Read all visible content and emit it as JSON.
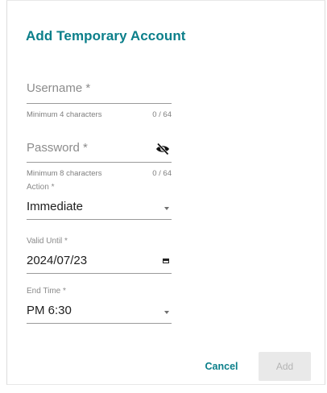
{
  "dialog": {
    "title": "Add Temporary Account"
  },
  "username": {
    "placeholder": "Username *",
    "hint": "Minimum 4 characters",
    "counter": "0 / 64"
  },
  "password": {
    "placeholder": "Password *",
    "hint": "Minimum 8 characters",
    "counter": "0 / 64",
    "visibility_icon": "eye-off-icon"
  },
  "action": {
    "label": "Action *",
    "value": "Immediate"
  },
  "valid_until": {
    "label": "Valid Until *",
    "value": "2024/07/23",
    "icon": "calendar-icon"
  },
  "end_time": {
    "label": "End Time *",
    "value": "PM 6:30"
  },
  "buttons": {
    "cancel": "Cancel",
    "add": "Add"
  },
  "colors": {
    "accent": "#0b7f8a",
    "disabled_bg": "#e9e9e9",
    "disabled_text": "#b4b4b4"
  }
}
